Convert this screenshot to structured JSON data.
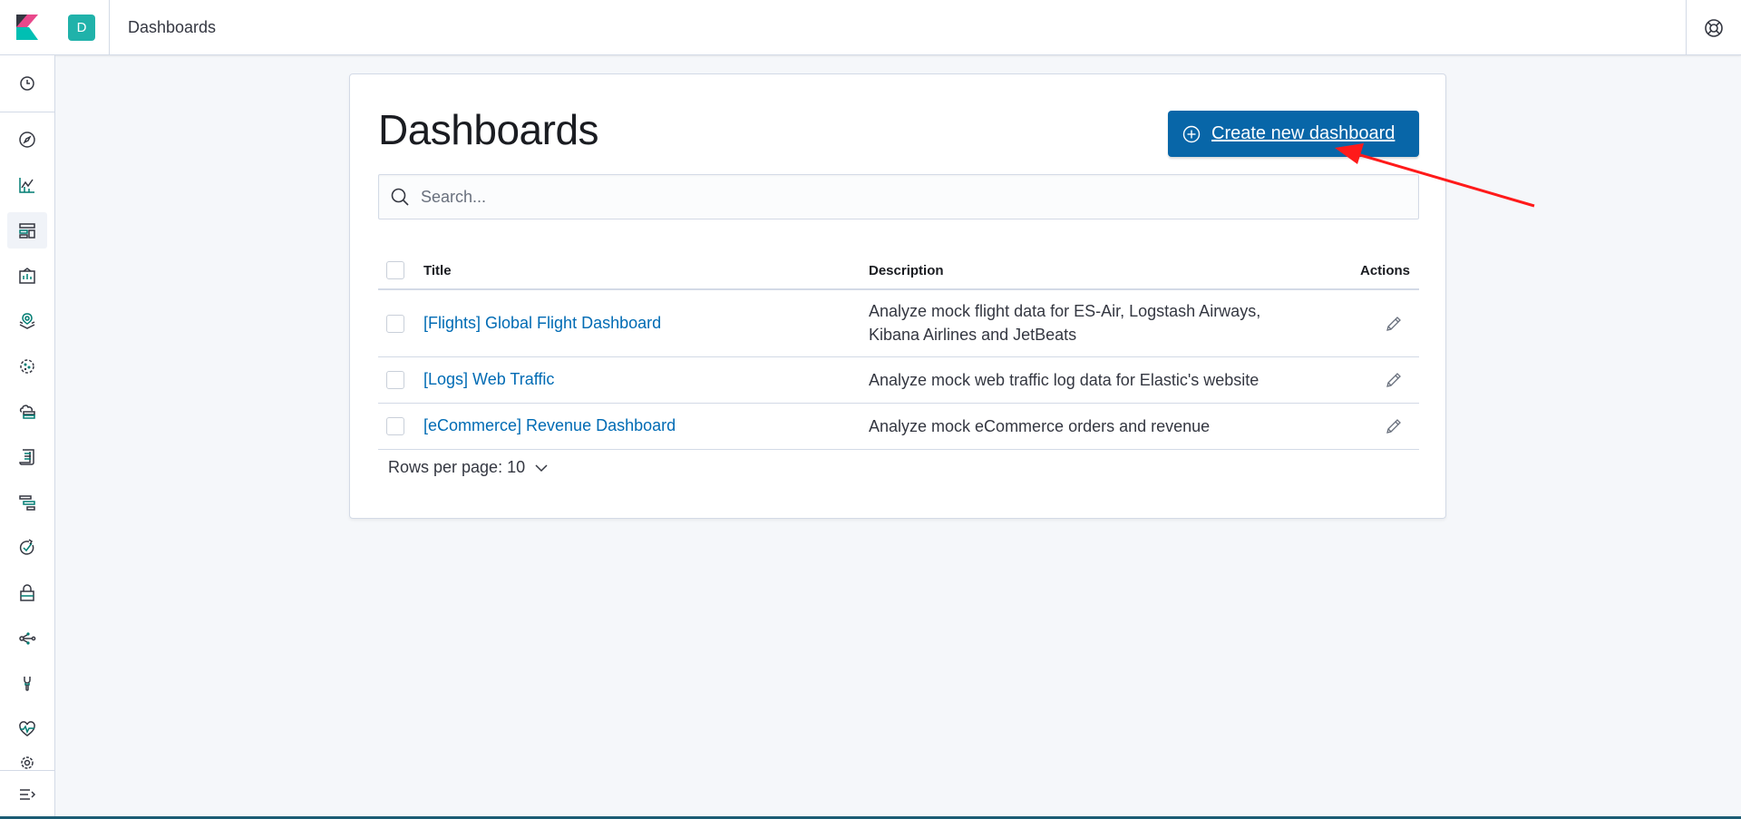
{
  "header": {
    "space_initial": "D",
    "breadcrumb": "Dashboards"
  },
  "main": {
    "title": "Dashboards",
    "create_button_label": "Create new dashboard",
    "search_placeholder": "Search...",
    "columns": {
      "title": "Title",
      "description": "Description",
      "actions": "Actions"
    },
    "rows": [
      {
        "title": "[Flights] Global Flight Dashboard",
        "description": "Analyze mock flight data for ES-Air, Logstash Airways, Kibana Airlines and JetBeats"
      },
      {
        "title": "[Logs] Web Traffic",
        "description": "Analyze mock web traffic log data for Elastic's website"
      },
      {
        "title": "[eCommerce] Revenue Dashboard",
        "description": "Analyze mock eCommerce orders and revenue"
      }
    ],
    "rows_per_page": "Rows per page: 10"
  },
  "sidenav_icons": [
    "recently-viewed-icon",
    "discover-icon",
    "visualize-icon",
    "dashboard-icon",
    "canvas-icon",
    "maps-icon",
    "ml-icon",
    "infrastructure-icon",
    "logs-icon",
    "apm-icon",
    "uptime-icon",
    "siem-icon",
    "graph-icon",
    "dev-tools-icon",
    "monitoring-icon",
    "management-icon",
    "collapse-icon"
  ],
  "colors": {
    "primary": "#0866a8",
    "link": "#006bb4",
    "space_avatar": "#20b2aa",
    "annotation_arrow": "#ff1a1a"
  }
}
